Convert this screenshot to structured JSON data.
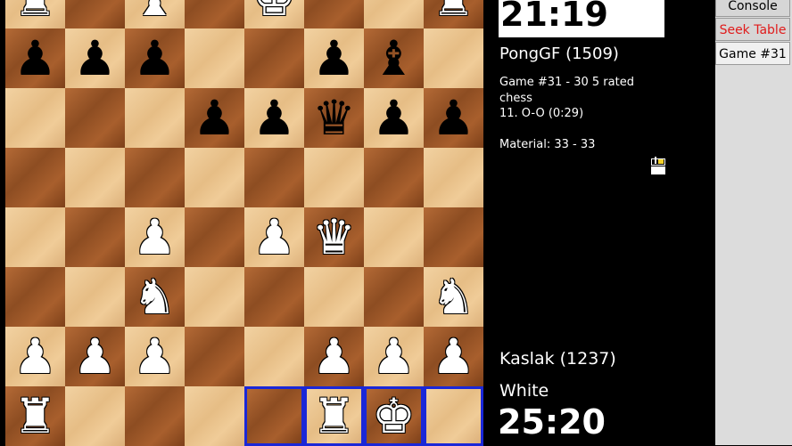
{
  "board": {
    "rows": [
      [
        "wR",
        "",
        "wB",
        "",
        "wK",
        "",
        "",
        "wR"
      ],
      [
        "bP",
        "bP",
        "bP",
        "",
        "",
        "bP",
        "bB",
        ""
      ],
      [
        "",
        "",
        "",
        "bP",
        "bP",
        "bQ",
        "bP",
        "bP"
      ],
      [
        "",
        "",
        "",
        "",
        "",
        "",
        "",
        ""
      ],
      [
        "",
        "",
        "wP",
        "",
        "wP",
        "wQ",
        "",
        ""
      ],
      [
        "",
        "",
        "wN",
        "",
        "",
        "",
        "",
        "wN"
      ],
      [
        "wP",
        "wP",
        "wP",
        "",
        "",
        "wP",
        "wP",
        "wP"
      ],
      [
        "wR",
        "",
        "",
        "",
        "",
        "wR",
        "wK",
        ""
      ]
    ],
    "highlighted": [
      [
        7,
        4
      ],
      [
        7,
        5
      ],
      [
        7,
        6
      ],
      [
        7,
        7
      ]
    ],
    "colors": {
      "light": "#efcd98",
      "dark": "#9a5a2c",
      "highlight": "#1a27d8"
    }
  },
  "pieces": {
    "wK": "♚",
    "wQ": "♛",
    "wR": "♜",
    "wB": "♝",
    "wN": "♞",
    "wP": "♟",
    "bK": "♚",
    "bQ": "♛",
    "bR": "♜",
    "bB": "♝",
    "bN": "♞",
    "bP": "♟"
  },
  "opponent": {
    "clock": "21:19",
    "name": "PongGF (1509)"
  },
  "game": {
    "description": "Game #31 - 30 5 rated chess",
    "last_move": "11. O-O (0:29)",
    "material": "Material: 33 - 33"
  },
  "player": {
    "name": "Kaslak (1237)",
    "color": "White",
    "clock": "25:20"
  },
  "tabs": [
    {
      "label": "Console"
    },
    {
      "label": "Seek Table"
    },
    {
      "label": "Game #31"
    }
  ]
}
